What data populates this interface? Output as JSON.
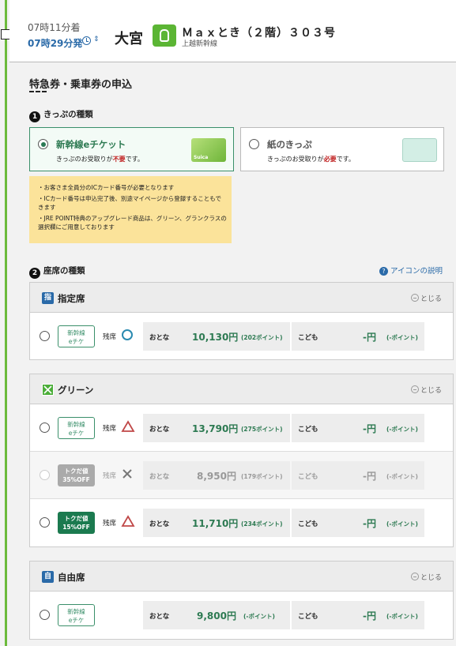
{
  "header": {
    "arrive_time": "07時11分着",
    "depart_time": "07時29分発",
    "station": "大宮",
    "train_name": "Ｍａｘとき（２階）３０３号",
    "train_line": "上越新幹線"
  },
  "page_title": "特急券・乗車券の申込",
  "ticket_type": {
    "heading": "きっぷの種類",
    "step": "1",
    "options": [
      {
        "title": "新幹線eチケット",
        "sub_prefix": "きっぷのお受取りが",
        "sub_em": "不要",
        "sub_suffix": "です。",
        "selected": true
      },
      {
        "title": "紙のきっぷ",
        "sub_prefix": "きっぷのお受取りが",
        "sub_em": "必要",
        "sub_suffix": "です。",
        "selected": false
      }
    ],
    "card_label": "Suica",
    "notice": [
      "・お客さま全員分のICカード番号が必要となります",
      "・ICカード番号は申込完了後、別途マイページから登録することもできます",
      "・JRE POINT特典のアップグレード商品は、グリーン、グランクラスの選択欄にご用意しております"
    ]
  },
  "seat_type": {
    "heading": "座席の種類",
    "step": "2",
    "help_label": "アイコンの説明",
    "close_label": "とじる",
    "adult_label": "おとな",
    "child_label": "こども",
    "sections": [
      {
        "icon_text": "指",
        "icon_color": "#2a6aa8",
        "label": "指定席",
        "rows": [
          {
            "badge": [
              "新幹線",
              "eチケ"
            ],
            "badge_style": "outline",
            "remain": "残席",
            "mark": "circle",
            "adult_price": "10,130円",
            "adult_points": "(202ポイント)",
            "child_price": "-円",
            "child_points": "(-ポイント)",
            "disabled": false
          }
        ]
      },
      {
        "icon_text": "",
        "icon_color": "#4cae3a",
        "label": "グリーン",
        "rows": [
          {
            "badge": [
              "新幹線",
              "eチケ"
            ],
            "badge_style": "outline",
            "remain": "残席",
            "mark": "triangle",
            "adult_price": "13,790円",
            "adult_points": "(275ポイント)",
            "child_price": "-円",
            "child_points": "(-ポイント)",
            "disabled": false
          },
          {
            "badge": [
              "トクだ値",
              "35%OFF"
            ],
            "badge_style": "gray",
            "remain": "残席",
            "mark": "cross",
            "adult_price": "8,950円",
            "adult_points": "(179ポイント)",
            "child_price": "-円",
            "child_points": "(-ポイント)",
            "disabled": true
          },
          {
            "badge": [
              "トクだ値",
              "15%OFF"
            ],
            "badge_style": "dark",
            "remain": "残席",
            "mark": "triangle",
            "adult_price": "11,710円",
            "adult_points": "(234ポイント)",
            "child_price": "-円",
            "child_points": "(-ポイント)",
            "disabled": false
          }
        ]
      },
      {
        "icon_text": "自",
        "icon_color": "#2a6aa8",
        "label": "自由席",
        "rows": [
          {
            "badge": [
              "新幹線",
              "eチケ"
            ],
            "badge_style": "outline",
            "remain": "",
            "mark": "",
            "adult_price": "9,800円",
            "adult_points": "(-ポイント)",
            "child_price": "-円",
            "child_points": "(-ポイント)",
            "disabled": false
          }
        ]
      }
    ]
  },
  "colors": {
    "accent_green": "#2d7a52",
    "rail_green": "#6cba3c",
    "link_blue": "#2a6aa8",
    "warn_red": "#c02020",
    "notice_yellow": "#fbe39a"
  }
}
